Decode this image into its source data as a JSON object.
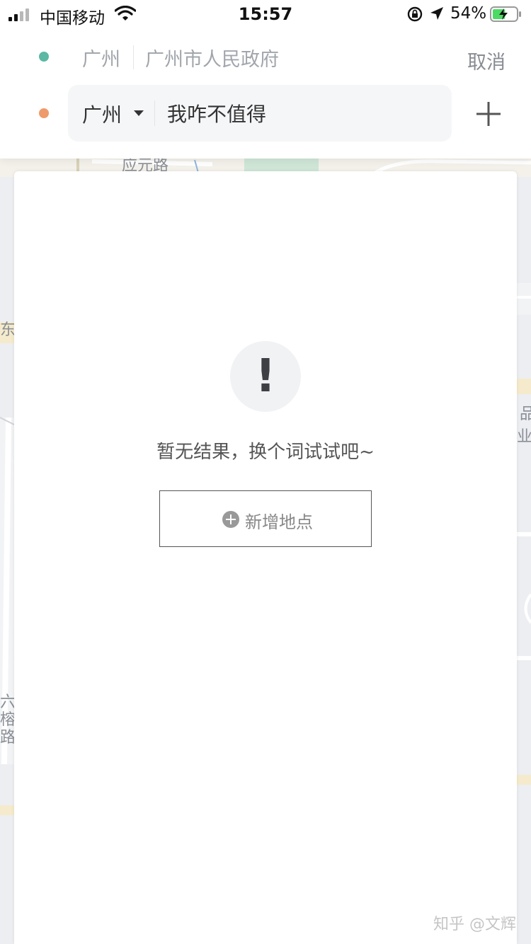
{
  "status_bar": {
    "carrier": "中国移动",
    "time": "15:57",
    "battery_percent": "54%",
    "battery_level": 0.54,
    "icons": [
      "signal-icon",
      "wifi-icon",
      "orientation-lock-icon",
      "location-arrow-icon",
      "battery-charging-icon"
    ]
  },
  "header": {
    "start": {
      "city": "广州",
      "place": "广州市人民政府"
    },
    "end": {
      "city": "广州",
      "query": "我咋不值得"
    },
    "cancel_label": "取消",
    "add_icon": "plus-icon",
    "city_caret_icon": "caret-down-icon"
  },
  "colors": {
    "start_dot": "#5bb8a3",
    "end_dot": "#ef9a6b"
  },
  "map": {
    "labels": [
      "应元路",
      "东",
      "业",
      "六",
      "榕",
      "路",
      "品"
    ]
  },
  "result": {
    "icon": "exclamation-icon",
    "empty_text": "暂无结果，换个词试试吧~",
    "add_place_icon": "plus-circle-icon",
    "add_place_label": "新增地点"
  },
  "watermark": "知乎 @文辉"
}
